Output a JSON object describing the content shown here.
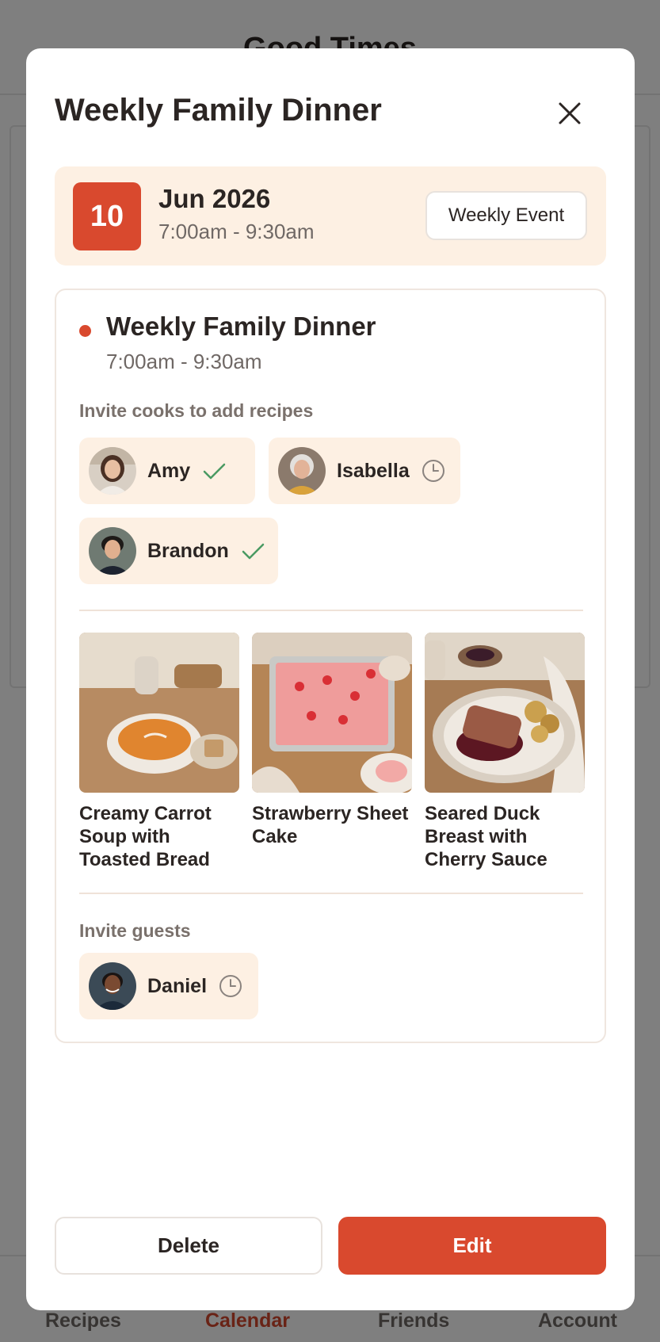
{
  "background_app": {
    "title": "Good Times",
    "nav": [
      "Recipes",
      "Calendar",
      "Friends",
      "Account"
    ],
    "active_nav": "Calendar"
  },
  "modal": {
    "title": "Weekly Family Dinner",
    "close_icon": "close-icon"
  },
  "date_banner": {
    "day": "10",
    "month_year": "Jun 2026",
    "time": "7:00am - 9:30am",
    "recurrence_badge": "Weekly Event"
  },
  "event": {
    "name": "Weekly Family Dinner",
    "time": "7:00am - 9:30am"
  },
  "cooks": {
    "label": "Invite cooks to add recipes",
    "people": [
      {
        "name": "Amy",
        "status": "accepted",
        "status_icon": "check-icon"
      },
      {
        "name": "Isabella",
        "status": "pending",
        "status_icon": "clock-icon"
      },
      {
        "name": "Brandon",
        "status": "accepted",
        "status_icon": "check-icon"
      }
    ]
  },
  "recipes": [
    {
      "title": "Creamy Carrot Soup with Toasted Bread"
    },
    {
      "title": "Strawberry Sheet Cake"
    },
    {
      "title": "Seared Duck Breast with Cherry Sauce"
    }
  ],
  "guests": {
    "label": "Invite guests",
    "people": [
      {
        "name": "Daniel",
        "status": "pending",
        "status_icon": "clock-icon"
      }
    ]
  },
  "actions": {
    "delete_label": "Delete",
    "edit_label": "Edit"
  },
  "colors": {
    "accent": "#d9492e",
    "chip_bg": "#fdf0e3",
    "accepted": "#4a9a62",
    "pending": "#8a837f"
  }
}
